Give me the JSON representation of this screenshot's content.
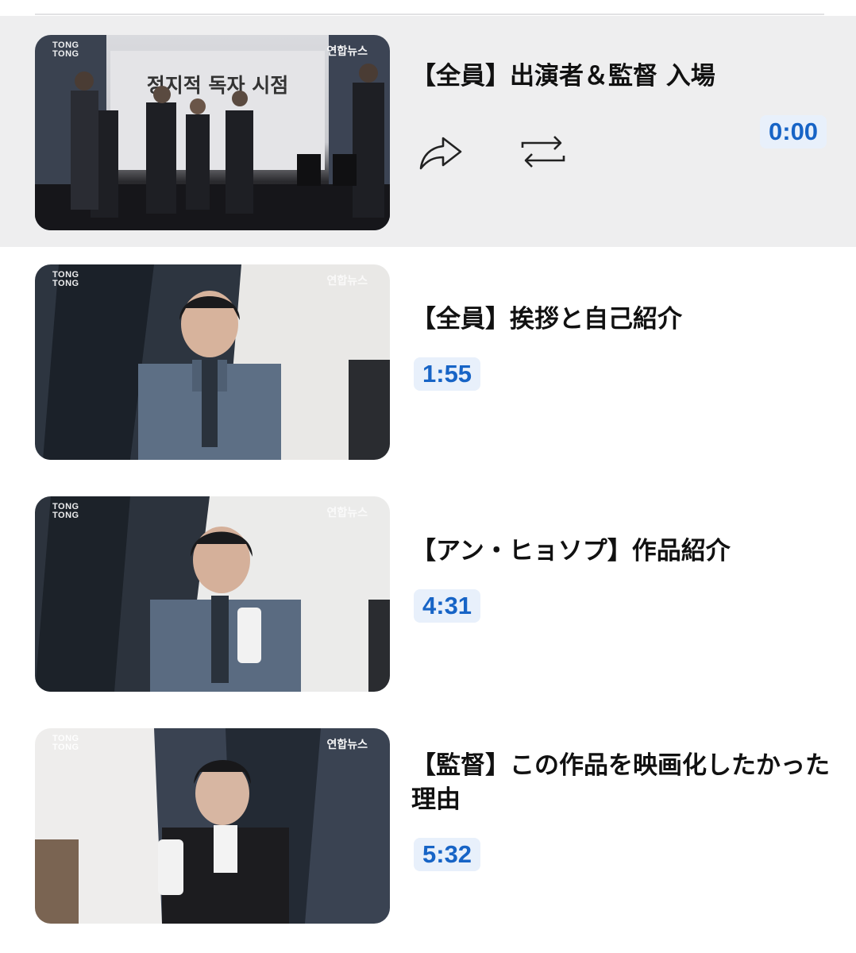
{
  "chapters": [
    {
      "title": "【全員】出演者＆監督 入場",
      "time": "0:00",
      "active": true,
      "watermark_left": "TONG\nTONG",
      "watermark_right": "연합뉴스",
      "thumbnail_text": "정지적 독자 시점"
    },
    {
      "title": "【全員】挨拶と自己紹介",
      "time": "1:55",
      "watermark_left": "TONG\nTONG",
      "watermark_right": "연합뉴스"
    },
    {
      "title": "【アン・ヒョソプ】作品紹介",
      "time": "4:31",
      "watermark_left": "TONG\nTONG",
      "watermark_right": "연합뉴스"
    },
    {
      "title": "【監督】この作品を映画化したかった理由",
      "time": "5:32",
      "watermark_left": "TONG\nTONG",
      "watermark_right": "연합뉴스"
    }
  ],
  "actions": {
    "share_icon": "share-icon",
    "repeat_icon": "repeat-icon"
  },
  "colors": {
    "active_bg": "#eeeeef",
    "time_text": "#1764c6",
    "time_bg": "#e8f0fb",
    "title_text": "#111111"
  }
}
